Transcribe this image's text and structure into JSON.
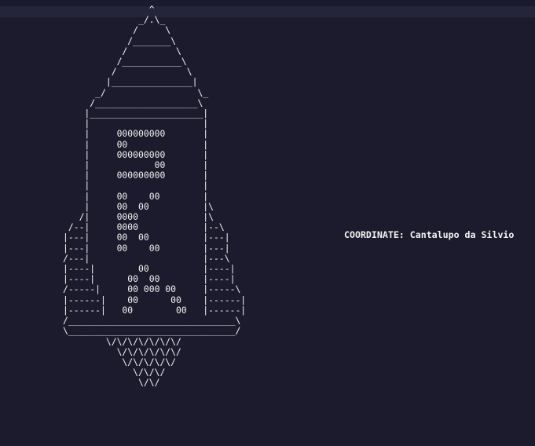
{
  "terminal": {
    "ascii_art": "                ^\n              _/.\\_\n             /     \\\n            /_______\\\n           /         \\\n          /___________\\\n         /             \\\n        |_______________|\n      _/                 \\_\n     /___________________\\\n    |_____________________|\n    |                     |\n    |     000000000       |\n    |     00              |\n    |     000000000       |\n    |            00       |\n    |     000000000       |\n    |                     |\n    |     00    00        |\n    |     00  00          |\\\n   /|     0000            |\\\n /--|     0000            |--\\\n|---|     00  00          |---|\n|---|     00    00        |---|\n/---|                     |---\\\n|----|        00          |----|\n|----|      00  00        |----|\n/-----|     00 000 00     |-----\\\n|------|    00      00    |------|\n|------|   00        00   |------|\n/_______________________________\\\n\\_______________________________/\n        \\/\\/\\/\\/\\/\\/\\/\n          \\/\\/\\/\\/\\/\\/\n           \\/\\/\\/\\/\\/\n             \\/\\/\\/\n              \\/\\/",
    "coordinate": "COORDINATE: Cantalupo da Silvio"
  },
  "colors": {
    "background": "#1b1b2d",
    "band": "#24243a",
    "text": "#f4f4f4"
  }
}
